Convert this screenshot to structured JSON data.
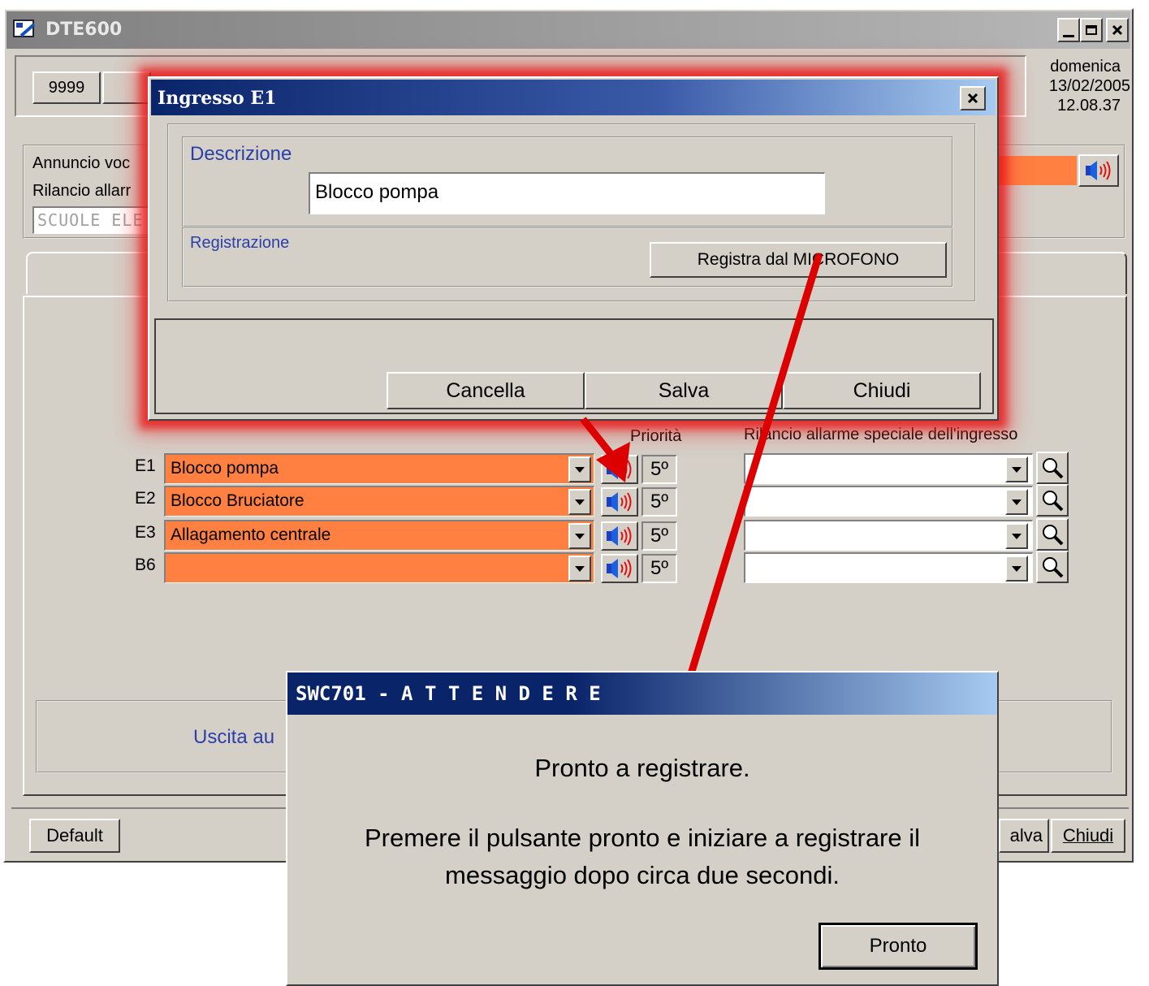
{
  "main_window": {
    "title": "DTE600",
    "code": "9999",
    "day": "domenica",
    "date": "13/02/2005",
    "time": "12.08.37",
    "label_annuncio": "Annuncio voc",
    "label_rilancio": "Rilancio allarr",
    "scuole": "SCUOLE ELE",
    "col_priorita": "Priorità",
    "col_rilancio": "Rilancio allarme speciale dell'ingresso",
    "inputs": [
      {
        "id": "E1",
        "value": "Blocco pompa",
        "priority": "5º"
      },
      {
        "id": "E2",
        "value": "Blocco Bruciatore",
        "priority": "5º"
      },
      {
        "id": "E3",
        "value": "Allagamento centrale",
        "priority": "5º"
      },
      {
        "id": "B6",
        "value": "",
        "priority": "5º"
      }
    ],
    "uscita_label": "Uscita au",
    "default_button": "Default",
    "salva_button": "alva",
    "chiudi_button": "Chiudi"
  },
  "dialog": {
    "title": "Ingresso E1",
    "descrizione_label": "Descrizione",
    "descrizione_value": "Blocco pompa",
    "registrazione_label": "Registrazione",
    "registra_button": "Registra dal MICROFONO",
    "cancella_button": "Cancella",
    "salva_button": "Salva",
    "chiudi_button": "Chiudi"
  },
  "message_box": {
    "title": "SWC701 - A T T E N D E R E",
    "line1": "Pronto a registrare.",
    "line2": "Premere il pulsante pronto e iniziare a registrare il",
    "line3": "messaggio dopo circa due secondi.",
    "pronto_button": "Pronto"
  },
  "colors": {
    "window_bg": "#d4d0c8",
    "orange_field": "#ff8040",
    "titlebar_dark": "#0a246a",
    "titlebar_light": "#a6caf0",
    "annotation_red": "#dd0000",
    "label_blue": "#2b3fa8"
  },
  "icons": [
    "app-icon",
    "minimize-icon",
    "maximize-icon",
    "close-icon",
    "speaker-icon",
    "magnifier-icon",
    "chevron-down-icon"
  ]
}
